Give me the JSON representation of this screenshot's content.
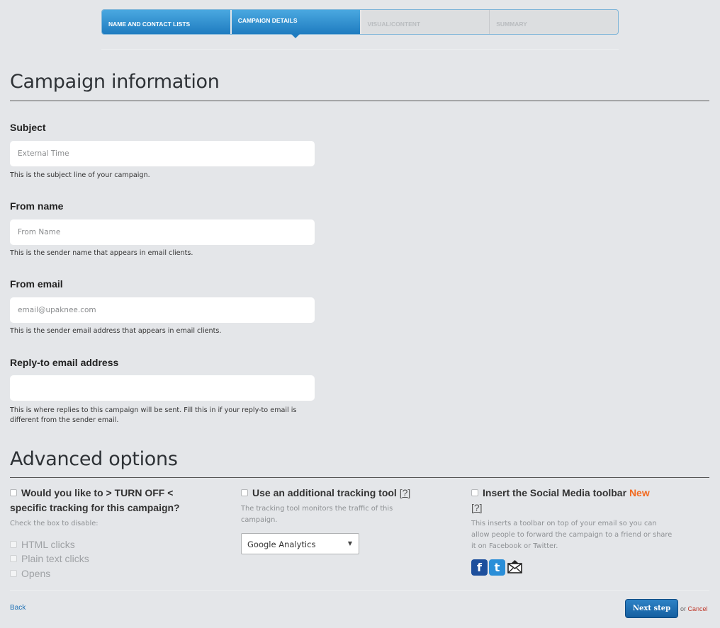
{
  "wizard": {
    "steps": [
      {
        "label": "NAME AND CONTACT LISTS",
        "state": "done"
      },
      {
        "label": "CAMPAIGN DETAILS",
        "state": "active"
      },
      {
        "label": "VISUAL/CONTENT",
        "state": "pending"
      },
      {
        "label": "SUMMARY",
        "state": "pending"
      }
    ]
  },
  "campaign": {
    "heading": "Campaign information",
    "subject": {
      "label": "Subject",
      "placeholder": "External Time",
      "value": "",
      "help": "This is the subject line of your campaign."
    },
    "from_name": {
      "label": "From name",
      "placeholder": "From Name",
      "value": "",
      "help": "This is the sender name that appears in email clients."
    },
    "from_email": {
      "label": "From email",
      "placeholder": "email@upaknee.com",
      "value": "",
      "help": "This is the sender email address that appears in email clients."
    },
    "reply_to": {
      "label": "Reply-to email address",
      "placeholder": "",
      "value": "",
      "help": "This is where replies to this campaign will be sent. Fill this in if your reply-to email is different from the sender email."
    }
  },
  "advanced": {
    "heading": "Advanced options",
    "tracking_off": {
      "title": "Would you like to > TURN OFF < specific tracking for this campaign?",
      "sub": "Check the box to disable:",
      "options": [
        "HTML clicks",
        "Plain text clicks",
        "Opens"
      ]
    },
    "tracking_tool": {
      "title": "Use an additional tracking tool",
      "help_link": "[?]",
      "sub": "The tracking tool monitors the traffic of this campaign.",
      "selected": "Google Analytics"
    },
    "social": {
      "title": "Insert the Social Media toolbar",
      "new_tag": "New",
      "help_link": "[?]",
      "sub": "This inserts a toolbar on top of your email so you can allow people to forward the campaign to a friend or share it on Facebook or Twitter.",
      "icons": [
        "facebook-icon",
        "twitter-icon",
        "forward-email-icon"
      ]
    }
  },
  "footer": {
    "back": "Back",
    "next": "Next step",
    "or": "or",
    "cancel": "Cancel"
  },
  "colors": {
    "background": "#e4e6e9",
    "step_active": "#1f7cc0",
    "new_tag": "#f26b21",
    "cancel": "#c0392b",
    "link": "#2273b6"
  }
}
